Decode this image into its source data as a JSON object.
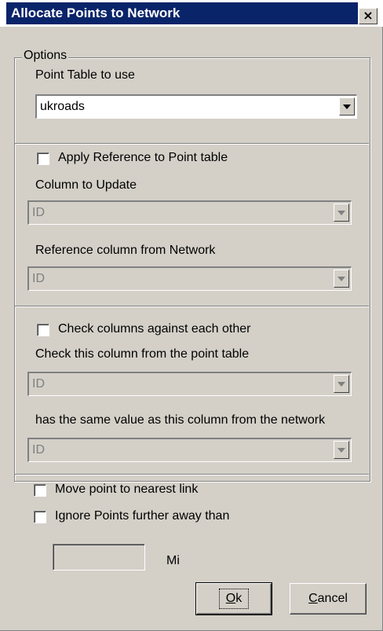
{
  "window": {
    "title": "Allocate Points to Network",
    "close_glyph": "×"
  },
  "options_group": {
    "legend": "Options",
    "point_table_label": "Point Table to use",
    "point_table_value": "ukroads"
  },
  "reference_section": {
    "apply_checkbox_label": "Apply Reference to Point table",
    "apply_checked": false,
    "column_to_update_label": "Column to Update",
    "column_to_update_value": "ID",
    "reference_column_label": "Reference column from Network",
    "reference_column_value": "ID"
  },
  "check_section": {
    "check_checkbox_label": "Check columns against each other",
    "check_checked": false,
    "point_column_label": "Check this column from the point table",
    "point_column_value": "ID",
    "network_column_label": "has the same value as this column from the network",
    "network_column_value": "ID"
  },
  "move_section": {
    "move_label": "Move point to nearest link",
    "move_checked": false,
    "ignore_label": "Ignore Points further away than",
    "ignore_checked": false,
    "distance_value": "",
    "unit_label": "Mi"
  },
  "buttons": {
    "ok_accel": "O",
    "ok_rest": "k",
    "cancel_accel": "C",
    "cancel_rest": "ancel"
  }
}
